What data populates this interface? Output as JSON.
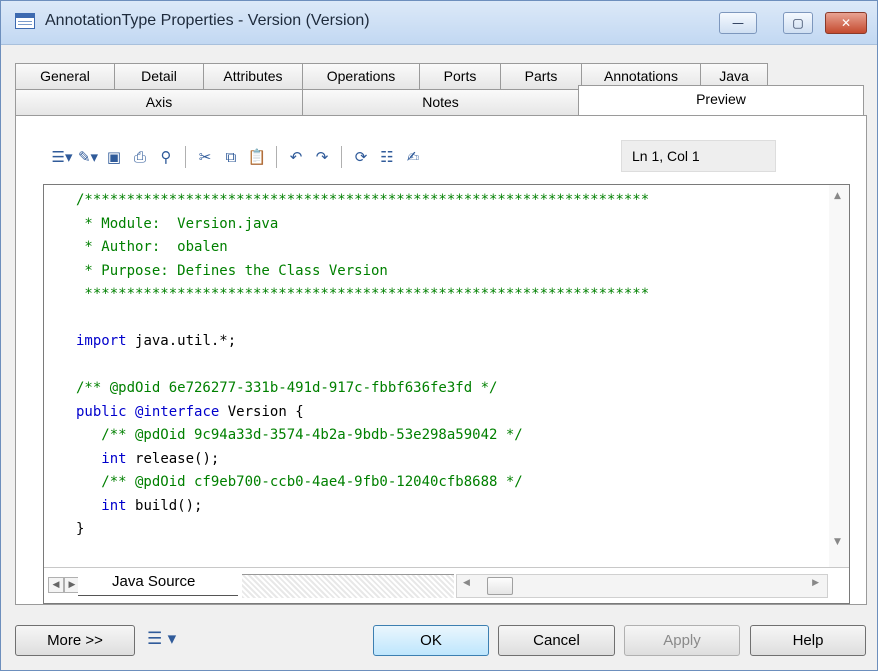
{
  "window": {
    "title": "AnnotationType Properties - Version (Version)",
    "min_label": "—",
    "max_label": "▢",
    "close_label": "✕"
  },
  "tabs_row1": [
    "General",
    "Detail",
    "Attributes",
    "Operations",
    "Ports",
    "Parts",
    "Annotations",
    "Java"
  ],
  "tabs_row2": [
    "Axis",
    "Notes",
    "Preview"
  ],
  "selected_tab": "Preview",
  "toolbar": {
    "position": "Ln 1, Col 1",
    "icons": [
      "editor-menu-icon",
      "edit-icon",
      "save-icon",
      "print-icon",
      "find-icon",
      "cut-icon",
      "copy-icon",
      "paste-icon",
      "undo-icon",
      "redo-icon",
      "refresh-icon",
      "list-icon",
      "edit-with-icon"
    ]
  },
  "code": {
    "lines": [
      "/*******************************************************************",
      " * Module:  Version.java",
      " * Author:  obalen",
      " * Purpose: Defines the Class Version",
      " *******************************************************************",
      "",
      "import java.util.*;",
      "",
      "/** @pdOid 6e726277-331b-491d-917c-fbbf636fe3fd */",
      "public @interface Version {",
      "   /** @pdOid 9c94a33d-3574-4b2a-9bdb-53e298a59042 */",
      "   int release();",
      "   /** @pdOid cf9eb700-ccb0-4ae4-9fb0-12040cfb8688 */",
      "   int build();",
      "}"
    ]
  },
  "editor_tab": "Java Source",
  "buttons": {
    "more": "More >>",
    "ok": "OK",
    "cancel": "Cancel",
    "apply": "Apply",
    "help": "Help"
  },
  "colors": {
    "comment": "#008000",
    "keyword": "#0000cc",
    "text": "#000000"
  }
}
